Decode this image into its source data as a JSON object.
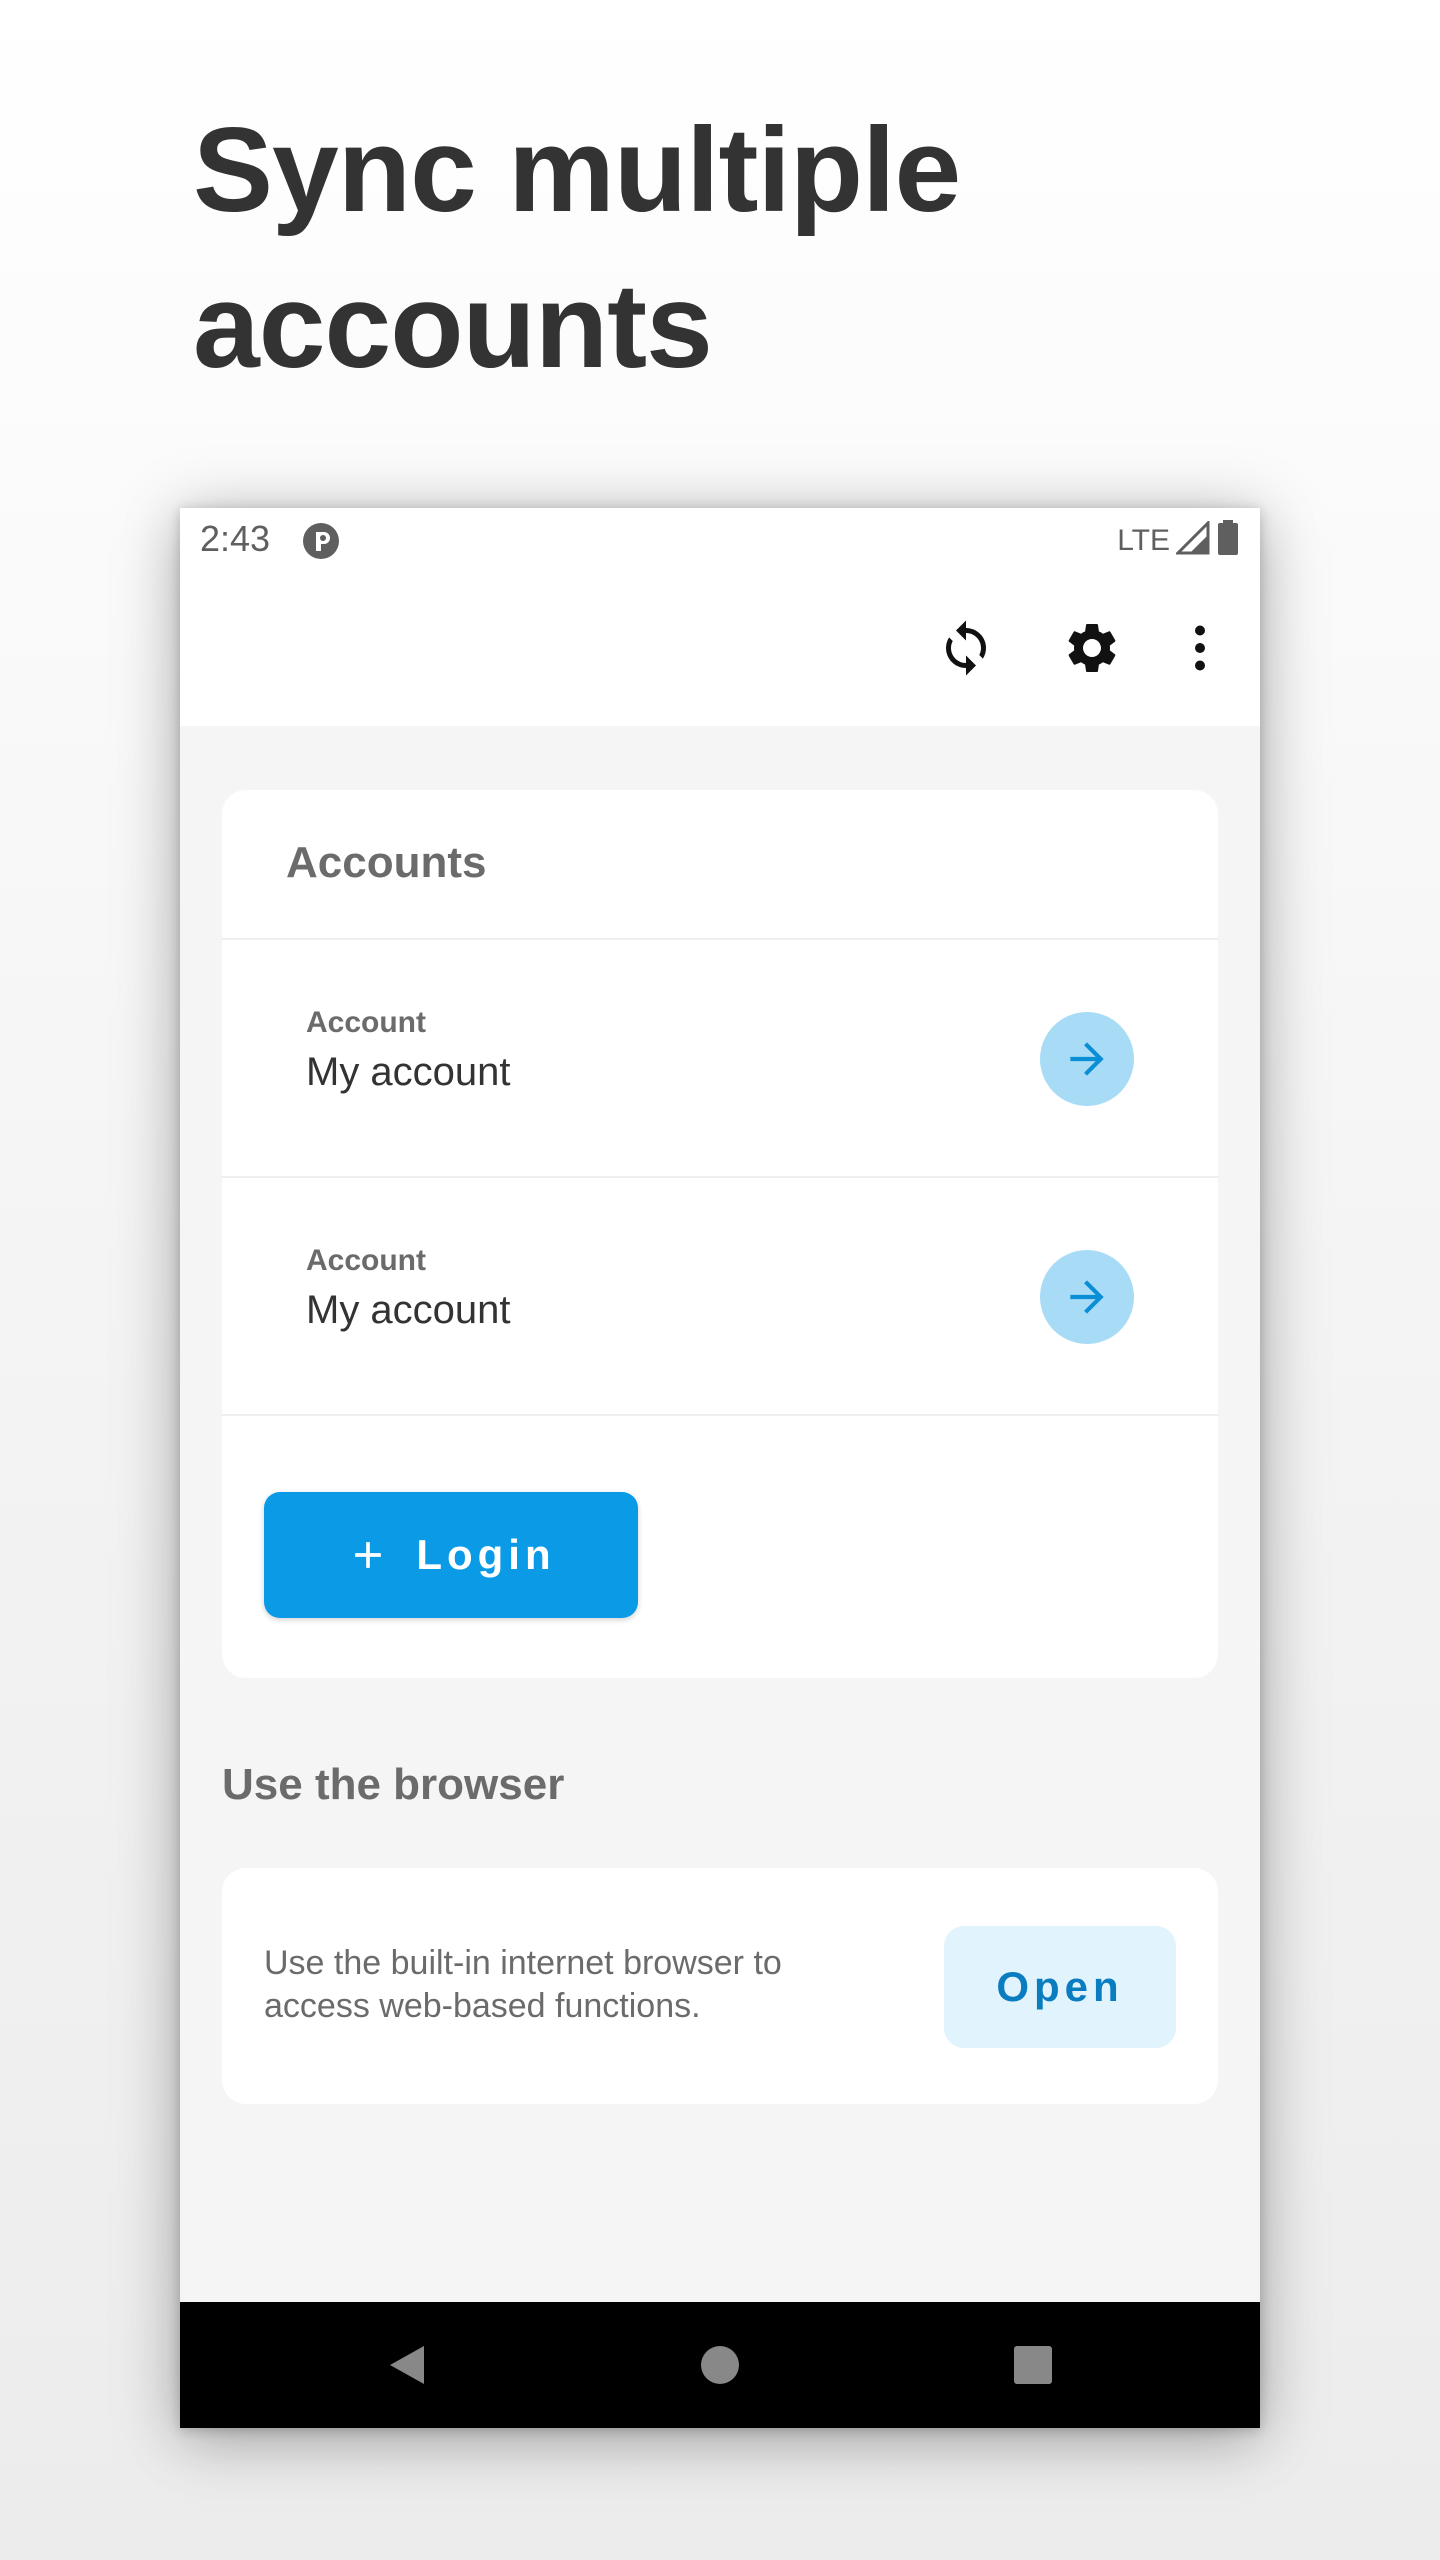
{
  "headline": "Sync multiple accounts",
  "status": {
    "time": "2:43",
    "network": "LTE"
  },
  "accounts": {
    "title": "Accounts",
    "items": [
      {
        "caption": "Account",
        "value": "My account"
      },
      {
        "caption": "Account",
        "value": "My account"
      }
    ],
    "login_label": "Login"
  },
  "browser": {
    "title": "Use the browser",
    "description": "Use the built-in internet browser to access web-based functions.",
    "open_label": "Open"
  },
  "icons": {
    "toolbar": [
      "sync-icon",
      "settings-gear-icon",
      "more-vertical-icon"
    ],
    "navigation": [
      "back-icon",
      "home-icon",
      "recents-icon"
    ]
  },
  "colors": {
    "accent": "#0a9ae6",
    "accent_light": "#a8dcf6",
    "open_button_bg": "#e1f4fd",
    "heading": "#333333",
    "muted_text": "#6b6b6b"
  }
}
